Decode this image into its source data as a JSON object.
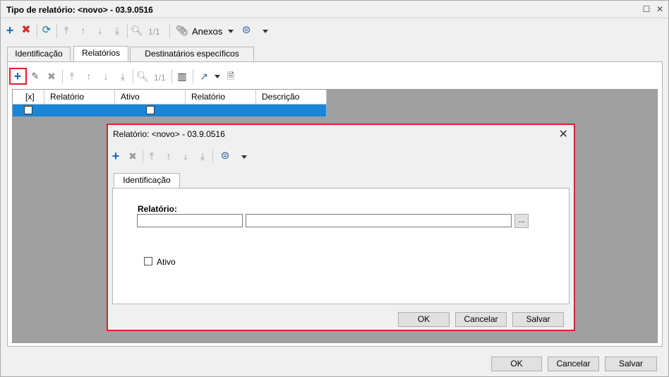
{
  "window": {
    "title": "Tipo de relatório: <novo> - 03.9.0516"
  },
  "main_toolbar": {
    "position_label": "1/1",
    "attachments_label": "Anexos"
  },
  "tabs": [
    {
      "label": "Identificação"
    },
    {
      "label": "Relatórios"
    },
    {
      "label": "Destinatários específicos"
    }
  ],
  "sub_toolbar": {
    "position_label": "1/1"
  },
  "grid": {
    "columns": [
      "[x]",
      "Relatório",
      "Ativo",
      "Relatório",
      "Descrição"
    ]
  },
  "dialog": {
    "title": "Relatório: <novo> - 03.9.0516",
    "tab_label": "Identificação",
    "relatorio_label": "Relatório:",
    "browse_label": "...",
    "ativo_label": "Ativo",
    "ok_label": "OK",
    "cancel_label": "Cancelar",
    "save_label": "Salvar"
  },
  "footer": {
    "ok_label": "OK",
    "cancel_label": "Cancelar",
    "save_label": "Salvar"
  },
  "colors": {
    "accent_blue": "#1565c0",
    "delete_red": "#d32f2f",
    "selection": "#1a86d9",
    "highlight_border": "#e0202c"
  }
}
